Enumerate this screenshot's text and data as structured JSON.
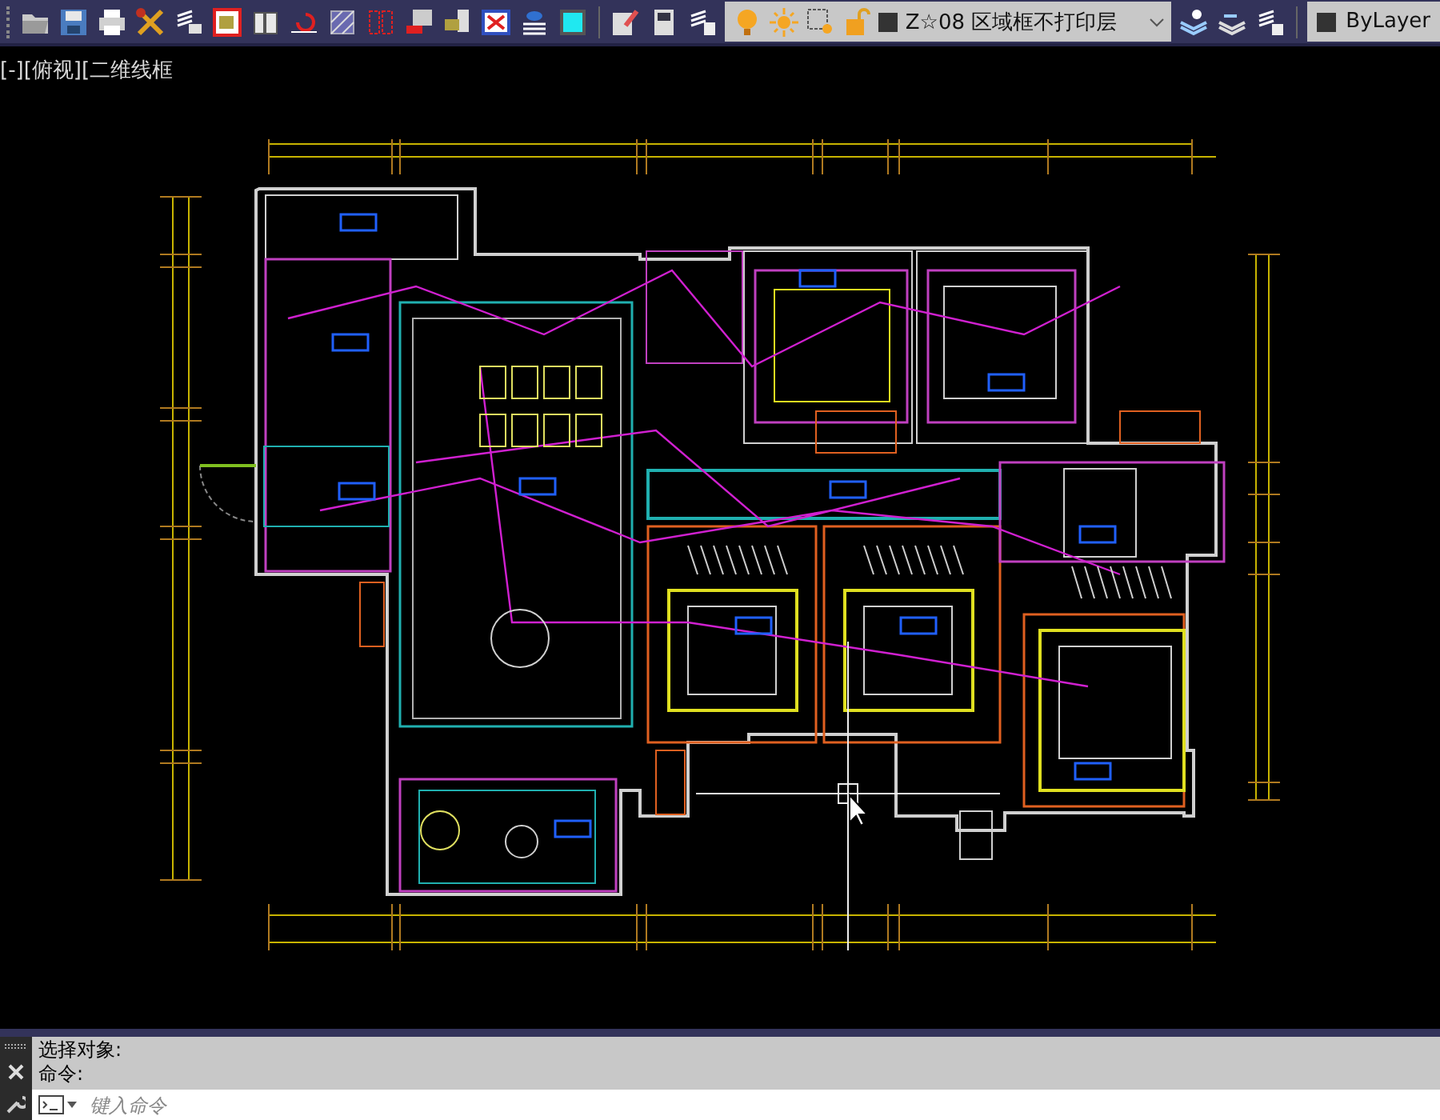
{
  "toolbar": {
    "layer": {
      "name": "Z☆08 区域框不打印层"
    },
    "color": {
      "name": "ByLayer"
    }
  },
  "viewport": {
    "label": "[-][俯视][二维线框"
  },
  "command_line": {
    "history": [
      "选择对象:",
      "命令:"
    ],
    "input": {
      "placeholder": "键入命令"
    }
  }
}
